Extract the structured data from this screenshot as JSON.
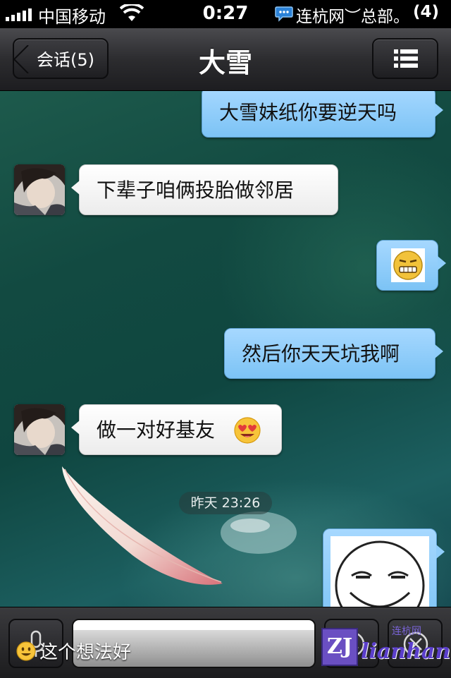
{
  "status_bar": {
    "carrier": "中国移动",
    "time": "0:27",
    "notification_text": "连杭网︶总部。",
    "notification_count": "(4)"
  },
  "nav": {
    "back_label": "会话(5)",
    "title": "大雪",
    "menu_icon": "list-icon"
  },
  "messages": [
    {
      "side": "out",
      "type": "text",
      "text": "大雪妹纸你要逆天吗"
    },
    {
      "side": "in",
      "type": "text",
      "text": "下辈子咱俩投胎做邻居"
    },
    {
      "side": "out",
      "type": "sticker",
      "icon": "grinning-face-icon"
    },
    {
      "side": "out",
      "type": "text",
      "text": "然后你天天坑我啊"
    },
    {
      "side": "in",
      "type": "text",
      "text": "做一对好基友",
      "emoji": "heart-eyes-icon"
    },
    {
      "side": "out",
      "type": "sticker",
      "icon": "smug-face-icon"
    }
  ],
  "timestamp": "昨天 23:26",
  "input": {
    "value": "",
    "placeholder": ""
  },
  "caption": {
    "text": "这个想法好",
    "icon": "smile-icon"
  },
  "watermark": {
    "logo": "ZJ",
    "site": "lianhang",
    "small": "连杭网"
  },
  "colors": {
    "outgoing_bubble": "#8fcdfa",
    "incoming_bubble": "#f6f6f6",
    "navbar": "#2c2c2f"
  }
}
